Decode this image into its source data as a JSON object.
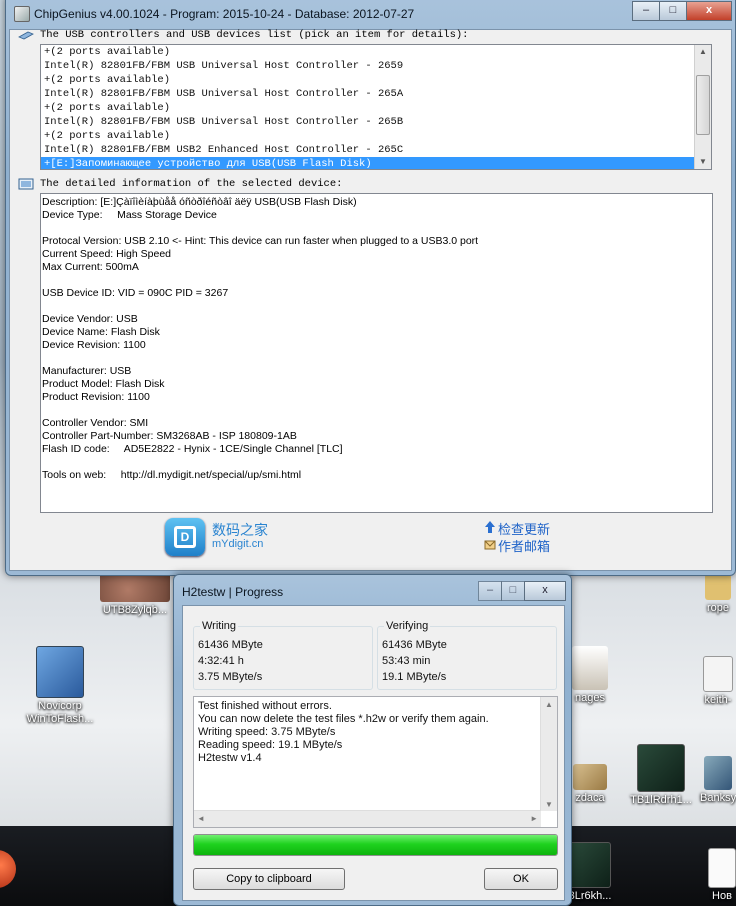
{
  "desktop": {
    "icons": [
      {
        "label": "UTB8Zylqb..."
      },
      {
        "label": "Novicorp WinToFlash..."
      },
      {
        "label": "rope"
      },
      {
        "label": "nages"
      },
      {
        "label": "keith-"
      },
      {
        "label": "zdaca"
      },
      {
        "label": "TB1lRdrh1..."
      },
      {
        "label": "Banksy"
      },
      {
        "label": "3Lr6kh..."
      },
      {
        "label": "Нов"
      }
    ]
  },
  "chipgenius": {
    "title": "ChipGenius v4.00.1024 - Program: 2015-10-24 - Database: 2012-07-27",
    "controls": {
      "minimize": "‒",
      "maximize": "□",
      "close": "x"
    },
    "devices_header": "The USB controllers and USB devices list (pick an item for details):",
    "devices": [
      "+(2 ports available)",
      "Intel(R) 82801FB/FBM USB Universal Host Controller - 2659",
      "+(2 ports available)",
      "Intel(R) 82801FB/FBM USB Universal Host Controller - 265A",
      "+(2 ports available)",
      "Intel(R) 82801FB/FBM USB Universal Host Controller - 265B",
      "+(2 ports available)",
      "Intel(R) 82801FB/FBM USB2 Enhanced Host Controller - 265C",
      "+[E:]Запоминающее устройство для USB(USB Flash Disk)"
    ],
    "selected_index": 8,
    "details_header": "The detailed information of the selected device:",
    "details": [
      "Description: [E:]Çàïîìèíàþùåå óñòðîéñòâî äëÿ USB(USB Flash Disk)",
      "Device Type:     Mass Storage Device",
      "",
      "Protocal Version: USB 2.10 <- Hint: This device can run faster when plugged to a USB3.0 port",
      "Current Speed: High Speed",
      "Max Current: 500mA",
      "",
      "USB Device ID: VID = 090C PID = 3267",
      "",
      "Device Vendor: USB",
      "Device Name: Flash Disk",
      "Device Revision: 1100",
      "",
      "Manufacturer: USB",
      "Product Model: Flash Disk",
      "Product Revision: 1100",
      "",
      "Controller Vendor: SMI",
      "Controller Part-Number: SM3268AB - ISP 180809-1AB",
      "Flash ID code:     AD5E2822 - Hynix - 1CE/Single Channel [TLC]",
      "",
      "Tools on web:     http://dl.mydigit.net/special/up/smi.html"
    ],
    "brand_cn": "数码之家",
    "brand_url": "mYdigit.cn",
    "check_update": "检查更新",
    "author_email": "作者邮箱"
  },
  "h2testw": {
    "title": "H2testw | Progress",
    "writing": {
      "label": "Writing",
      "size": "61436 MByte",
      "time": "4:32:41 h",
      "speed": "3.75 MByte/s"
    },
    "verifying": {
      "label": "Verifying",
      "size": "61436 MByte",
      "time": "53:43 min",
      "speed": "19.1 MByte/s"
    },
    "log": [
      "Test finished without errors.",
      "You can now delete the test files *.h2w or verify them again.",
      "Writing speed: 3.75 MByte/s",
      "Reading speed: 19.1 MByte/s",
      "H2testw v1.4"
    ],
    "progress_fraction": 1.0,
    "copy_button": "Copy to clipboard",
    "ok_button": "OK"
  }
}
